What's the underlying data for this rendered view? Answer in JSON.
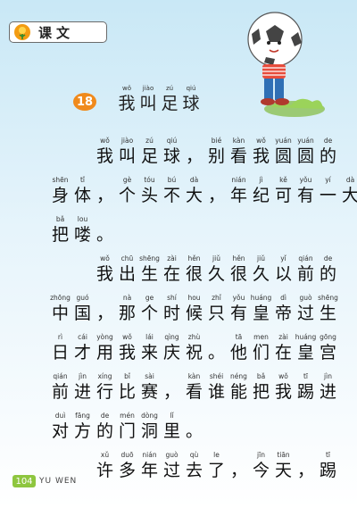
{
  "header": {
    "tag_label": "课文"
  },
  "lesson": {
    "number": "18",
    "title": [
      {
        "py": "wǒ",
        "hz": "我"
      },
      {
        "py": "jiào",
        "hz": "叫"
      },
      {
        "py": "zú",
        "hz": "足"
      },
      {
        "py": "qiú",
        "hz": "球"
      }
    ]
  },
  "body": {
    "lines": [
      [
        {
          "py": "",
          "hz": ""
        },
        {
          "py": "",
          "hz": ""
        },
        {
          "py": "wǒ",
          "hz": "我"
        },
        {
          "py": "jiào",
          "hz": "叫"
        },
        {
          "py": "zú",
          "hz": "足"
        },
        {
          "py": "qiú",
          "hz": "球"
        },
        {
          "py": "",
          "hz": "，"
        },
        {
          "py": "bié",
          "hz": "别"
        },
        {
          "py": "kàn",
          "hz": "看"
        },
        {
          "py": "wǒ",
          "hz": "我"
        },
        {
          "py": "yuán",
          "hz": "圆"
        },
        {
          "py": "yuán",
          "hz": "圆"
        },
        {
          "py": "de",
          "hz": "的"
        }
      ],
      [
        {
          "py": "shēn",
          "hz": "身"
        },
        {
          "py": "tǐ",
          "hz": "体"
        },
        {
          "py": "",
          "hz": "，"
        },
        {
          "py": "gè",
          "hz": "个"
        },
        {
          "py": "tóu",
          "hz": "头"
        },
        {
          "py": "bú",
          "hz": "不"
        },
        {
          "py": "dà",
          "hz": "大"
        },
        {
          "py": "",
          "hz": "，"
        },
        {
          "py": "nián",
          "hz": "年"
        },
        {
          "py": "jì",
          "hz": "纪"
        },
        {
          "py": "kě",
          "hz": "可"
        },
        {
          "py": "yǒu",
          "hz": "有"
        },
        {
          "py": "yí",
          "hz": "一"
        },
        {
          "py": "dà",
          "hz": "大"
        }
      ],
      [
        {
          "py": "bǎ",
          "hz": "把"
        },
        {
          "py": "lou",
          "hz": "喽"
        },
        {
          "py": "",
          "hz": "。"
        }
      ],
      [
        {
          "py": "",
          "hz": ""
        },
        {
          "py": "",
          "hz": ""
        },
        {
          "py": "wǒ",
          "hz": "我"
        },
        {
          "py": "chū",
          "hz": "出"
        },
        {
          "py": "shēng",
          "hz": "生"
        },
        {
          "py": "zài",
          "hz": "在"
        },
        {
          "py": "hěn",
          "hz": "很"
        },
        {
          "py": "jiǔ",
          "hz": "久"
        },
        {
          "py": "hěn",
          "hz": "很"
        },
        {
          "py": "jiǔ",
          "hz": "久"
        },
        {
          "py": "yǐ",
          "hz": "以"
        },
        {
          "py": "qián",
          "hz": "前"
        },
        {
          "py": "de",
          "hz": "的"
        }
      ],
      [
        {
          "py": "zhōng",
          "hz": "中"
        },
        {
          "py": "guó",
          "hz": "国"
        },
        {
          "py": "",
          "hz": "，"
        },
        {
          "py": "nà",
          "hz": "那"
        },
        {
          "py": "ge",
          "hz": "个"
        },
        {
          "py": "shí",
          "hz": "时"
        },
        {
          "py": "hou",
          "hz": "候"
        },
        {
          "py": "zhǐ",
          "hz": "只"
        },
        {
          "py": "yǒu",
          "hz": "有"
        },
        {
          "py": "huáng",
          "hz": "皇"
        },
        {
          "py": "dì",
          "hz": "帝"
        },
        {
          "py": "guò",
          "hz": "过"
        },
        {
          "py": "shēng",
          "hz": "生"
        }
      ],
      [
        {
          "py": "rì",
          "hz": "日"
        },
        {
          "py": "cái",
          "hz": "才"
        },
        {
          "py": "yòng",
          "hz": "用"
        },
        {
          "py": "wǒ",
          "hz": "我"
        },
        {
          "py": "lái",
          "hz": "来"
        },
        {
          "py": "qìng",
          "hz": "庆"
        },
        {
          "py": "zhù",
          "hz": "祝"
        },
        {
          "py": "",
          "hz": "。"
        },
        {
          "py": "tā",
          "hz": "他"
        },
        {
          "py": "men",
          "hz": "们"
        },
        {
          "py": "zài",
          "hz": "在"
        },
        {
          "py": "huáng",
          "hz": "皇"
        },
        {
          "py": "gōng",
          "hz": "宫"
        }
      ],
      [
        {
          "py": "qián",
          "hz": "前"
        },
        {
          "py": "jìn",
          "hz": "进"
        },
        {
          "py": "xíng",
          "hz": "行"
        },
        {
          "py": "bǐ",
          "hz": "比"
        },
        {
          "py": "sài",
          "hz": "赛"
        },
        {
          "py": "",
          "hz": "，"
        },
        {
          "py": "kàn",
          "hz": "看"
        },
        {
          "py": "shéi",
          "hz": "谁"
        },
        {
          "py": "néng",
          "hz": "能"
        },
        {
          "py": "bǎ",
          "hz": "把"
        },
        {
          "py": "wǒ",
          "hz": "我"
        },
        {
          "py": "tī",
          "hz": "踢"
        },
        {
          "py": "jìn",
          "hz": "进"
        }
      ],
      [
        {
          "py": "duì",
          "hz": "对"
        },
        {
          "py": "fāng",
          "hz": "方"
        },
        {
          "py": "de",
          "hz": "的"
        },
        {
          "py": "mén",
          "hz": "门"
        },
        {
          "py": "dòng",
          "hz": "洞"
        },
        {
          "py": "lǐ",
          "hz": "里"
        },
        {
          "py": "",
          "hz": "。"
        }
      ],
      [
        {
          "py": "",
          "hz": ""
        },
        {
          "py": "",
          "hz": ""
        },
        {
          "py": "xǔ",
          "hz": "许"
        },
        {
          "py": "duō",
          "hz": "多"
        },
        {
          "py": "nián",
          "hz": "年"
        },
        {
          "py": "guò",
          "hz": "过"
        },
        {
          "py": "qù",
          "hz": "去"
        },
        {
          "py": "le",
          "hz": "了"
        },
        {
          "py": "",
          "hz": "，"
        },
        {
          "py": "jīn",
          "hz": "今"
        },
        {
          "py": "tiān",
          "hz": "天"
        },
        {
          "py": "",
          "hz": "，"
        },
        {
          "py": "tī",
          "hz": "踢"
        }
      ]
    ]
  },
  "footer": {
    "page_number": "104",
    "label": "YU WEN"
  },
  "colors": {
    "accent_orange": "#f08a1c",
    "page_green": "#8ec63f"
  }
}
